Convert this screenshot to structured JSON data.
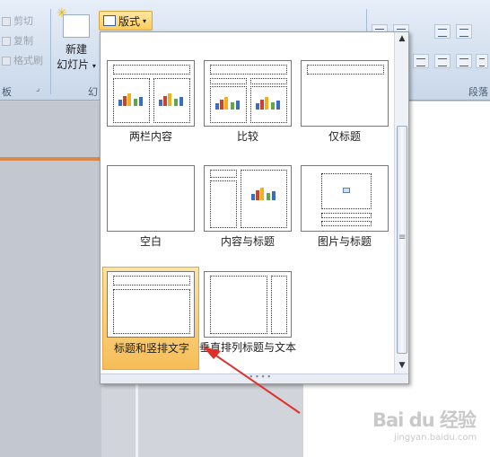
{
  "ribbon": {
    "clipboard": {
      "cut": "剪切",
      "copy": "复制",
      "format_painter": "格式刷",
      "group_label_partial": "板"
    },
    "slides": {
      "new_slide_line1": "新建",
      "new_slide_line2": "幻灯片",
      "layout_button": "版式",
      "group_label_partial": "幻"
    },
    "paragraph": {
      "group_label_partial": "段落"
    }
  },
  "layout_gallery": {
    "items": [
      {
        "label": "两栏内容"
      },
      {
        "label": "比较"
      },
      {
        "label": "仅标题"
      },
      {
        "label": "空白"
      },
      {
        "label": "内容与标题"
      },
      {
        "label": "图片与标题"
      },
      {
        "label": "标题和竖排文字",
        "selected": true
      },
      {
        "label": "垂直排列标题与文本"
      }
    ]
  },
  "watermark": {
    "text": "Bai du 经验",
    "url": "jingyan.baidu.com"
  },
  "colors": {
    "selected_bg": "#f6bd57",
    "arrow": "#e0302a"
  }
}
